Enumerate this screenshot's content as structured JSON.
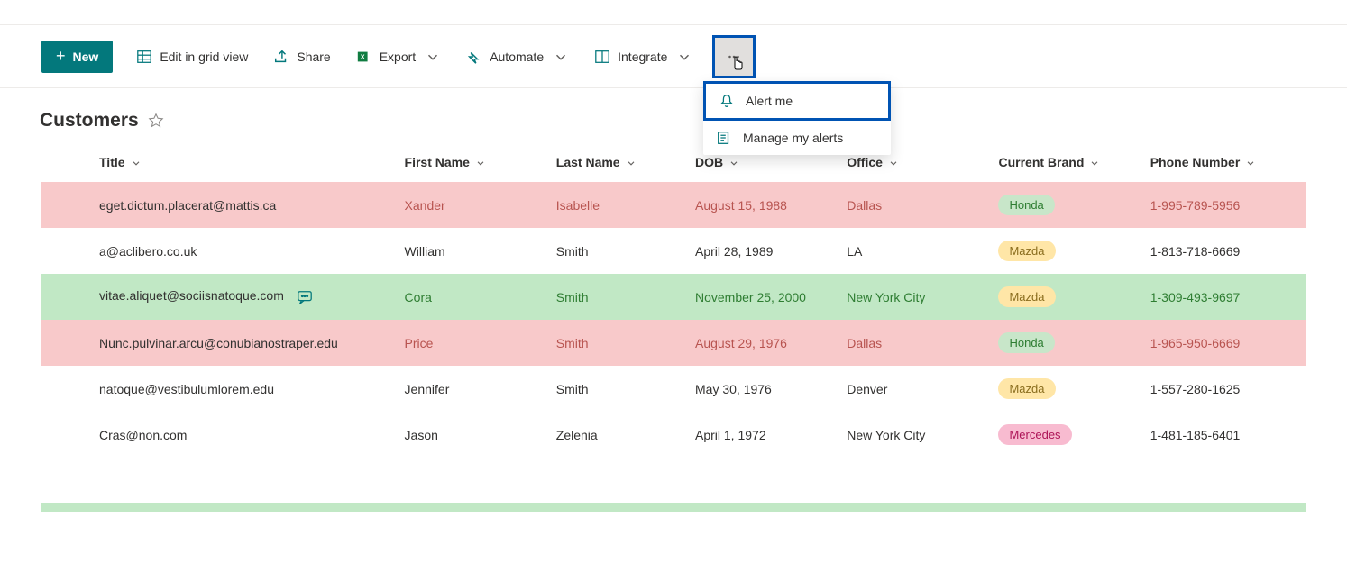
{
  "toolbar": {
    "new_label": "New",
    "edit_grid_label": "Edit in grid view",
    "share_label": "Share",
    "export_label": "Export",
    "automate_label": "Automate",
    "integrate_label": "Integrate"
  },
  "dropdown": {
    "alert_me_label": "Alert me",
    "manage_alerts_label": "Manage my alerts"
  },
  "page": {
    "title": "Customers"
  },
  "columns": {
    "title": "Title",
    "first_name": "First Name",
    "last_name": "Last Name",
    "dob": "DOB",
    "office": "Office",
    "current_brand": "Current Brand",
    "phone": "Phone Number"
  },
  "rows": [
    {
      "title": "eget.dictum.placerat@mattis.ca",
      "first_name": "Xander",
      "last_name": "Isabelle",
      "dob": "August 15, 1988",
      "office": "Dallas",
      "brand": "Honda",
      "brand_style": "pill-honda",
      "phone": "1-995-789-5956",
      "row_style": "row-pink",
      "has_comment": false
    },
    {
      "title": "a@aclibero.co.uk",
      "first_name": "William",
      "last_name": "Smith",
      "dob": "April 28, 1989",
      "office": "LA",
      "brand": "Mazda",
      "brand_style": "pill-mazda",
      "phone": "1-813-718-6669",
      "row_style": "",
      "has_comment": false
    },
    {
      "title": "vitae.aliquet@sociisnatoque.com",
      "first_name": "Cora",
      "last_name": "Smith",
      "dob": "November 25, 2000",
      "office": "New York City",
      "brand": "Mazda",
      "brand_style": "pill-mazda",
      "phone": "1-309-493-9697",
      "row_style": "row-green",
      "has_comment": true
    },
    {
      "title": "Nunc.pulvinar.arcu@conubianostraper.edu",
      "first_name": "Price",
      "last_name": "Smith",
      "dob": "August 29, 1976",
      "office": "Dallas",
      "brand": "Honda",
      "brand_style": "pill-honda",
      "phone": "1-965-950-6669",
      "row_style": "row-pink",
      "has_comment": false
    },
    {
      "title": "natoque@vestibulumlorem.edu",
      "first_name": "Jennifer",
      "last_name": "Smith",
      "dob": "May 30, 1976",
      "office": "Denver",
      "brand": "Mazda",
      "brand_style": "pill-mazda",
      "phone": "1-557-280-1625",
      "row_style": "",
      "has_comment": false
    },
    {
      "title": "Cras@non.com",
      "first_name": "Jason",
      "last_name": "Zelenia",
      "dob": "April 1, 1972",
      "office": "New York City",
      "brand": "Mercedes",
      "brand_style": "pill-mercedes",
      "phone": "1-481-185-6401",
      "row_style": "",
      "has_comment": false
    }
  ]
}
